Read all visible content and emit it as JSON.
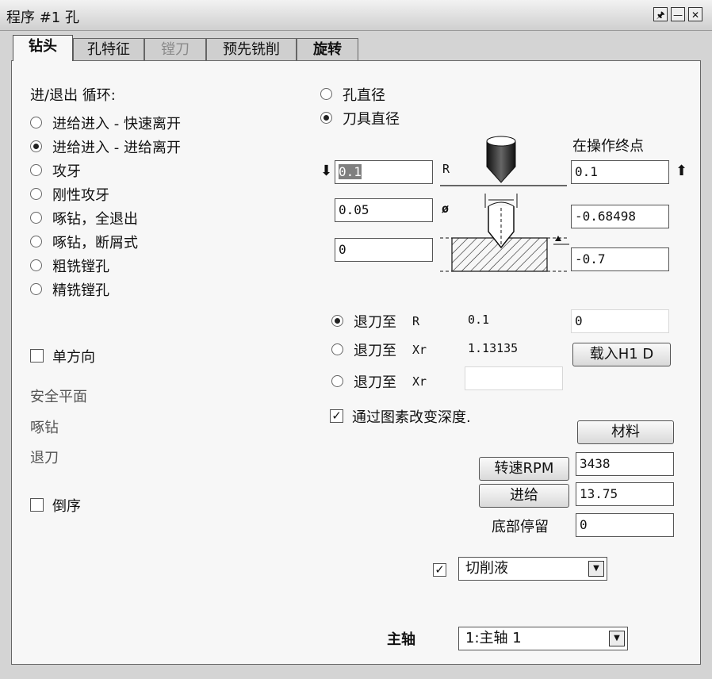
{
  "window": {
    "title": "程序 #1 孔"
  },
  "title_buttons": {
    "pin": "🖈",
    "minimize": "—",
    "close": "✕"
  },
  "tabs": [
    {
      "label": "钻头"
    },
    {
      "label": "孔特征"
    },
    {
      "label": "镗刀"
    },
    {
      "label": "预先铣削"
    },
    {
      "label": "旋转"
    }
  ],
  "cycle": {
    "heading": "进/退出 循环:",
    "options": [
      "进给进入 - 快速离开",
      "进给进入 - 进给离开",
      "攻牙",
      "刚性攻牙",
      "啄钻，全退出",
      "啄钻，断屑式",
      "粗铣镗孔",
      "精铣镗孔"
    ],
    "selected_index": 1
  },
  "single_direction": {
    "label": "单方向",
    "checked": false
  },
  "static_labels": {
    "safe_plane": "安全平面",
    "peck": "啄钻",
    "retract": "退刀"
  },
  "reverse": {
    "label": "倒序",
    "checked": false
  },
  "diameter_mode": {
    "hole_diameter": "孔直径",
    "tool_diameter": "刀具直径",
    "selected": "tool_diameter"
  },
  "at_op_end": "在操作终点",
  "diagram": {
    "r_label": "R",
    "dia_label": "ø"
  },
  "inputs": {
    "left_top": "0.1",
    "left_mid": "0.05",
    "left_bottom": "0",
    "right_top": "0.1",
    "right_mid": "-0.68498",
    "right_bottom": "-0.7"
  },
  "retract": {
    "options": [
      {
        "label": "退刀至",
        "code": "R",
        "value": "0.1"
      },
      {
        "label": "退刀至",
        "code": "Xr",
        "value": "1.13135"
      },
      {
        "label": "退刀至",
        "code": "Xr",
        "value": ""
      }
    ],
    "selected_index": 0,
    "right_value": "0",
    "load_button": "载入H1 D"
  },
  "depth_by_geometry": {
    "label": "通过图素改变深度.",
    "checked": true
  },
  "material_button": "材料",
  "speed": {
    "button": "转速RPM",
    "value": "3438"
  },
  "feed": {
    "button": "进给",
    "value": "13.75"
  },
  "dwell": {
    "label": "底部停留",
    "value": "0"
  },
  "coolant": {
    "checked": true,
    "value": "切削液"
  },
  "spindle": {
    "label": "主轴",
    "value": "1:主轴 1"
  }
}
